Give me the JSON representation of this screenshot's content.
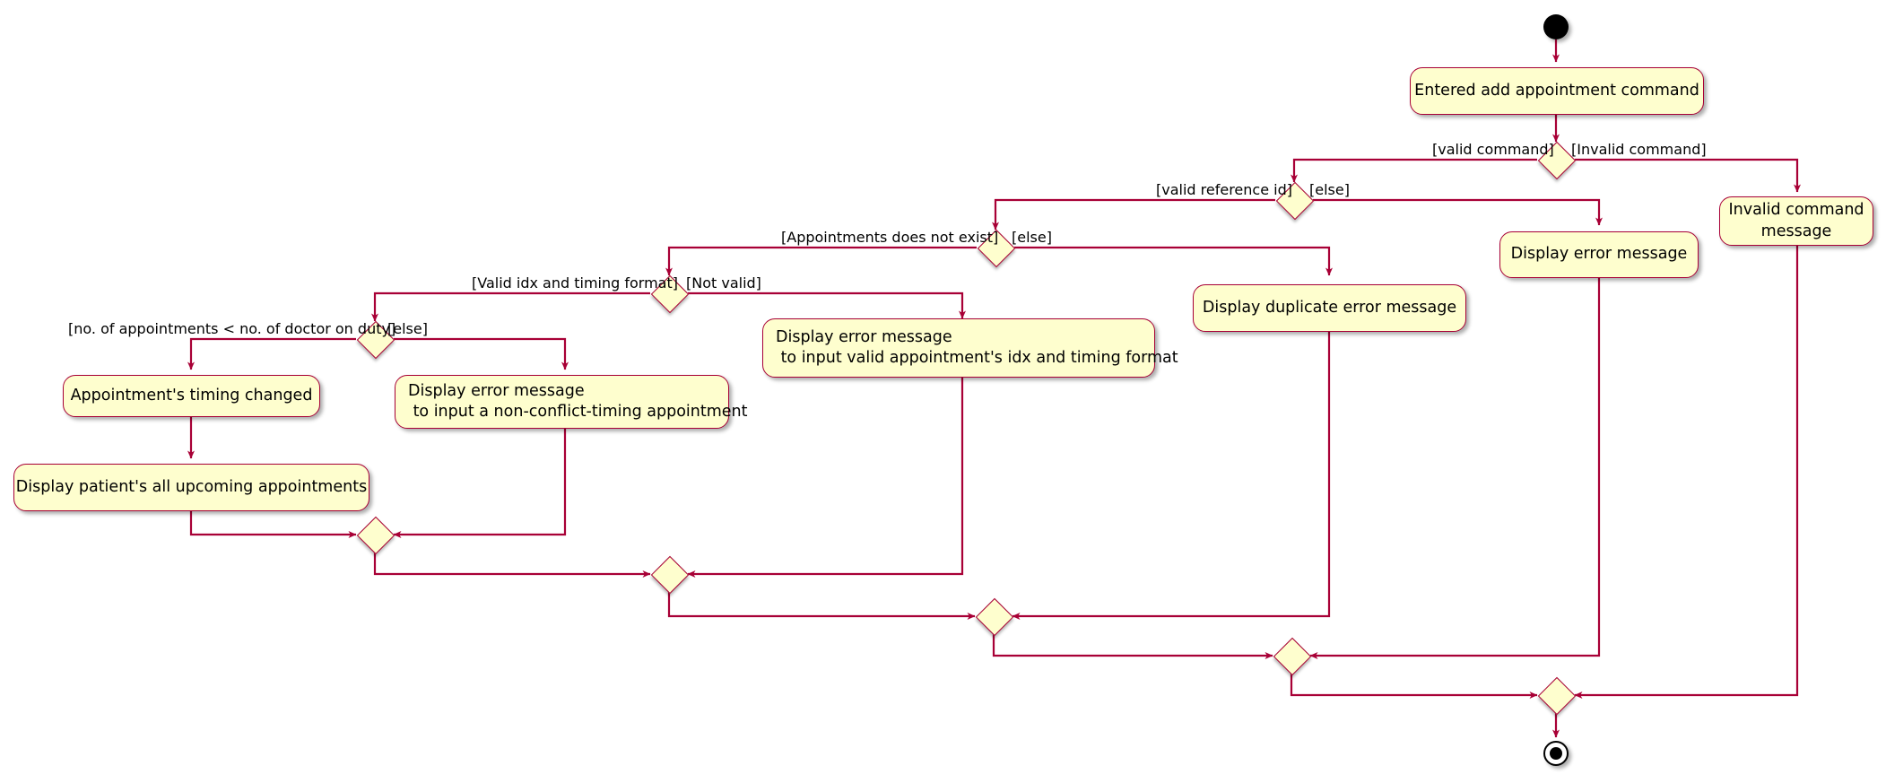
{
  "diagram": {
    "type": "uml-activity-diagram",
    "title": "Add appointment command activity diagram",
    "colors": {
      "node_fill": "#FEFECE",
      "node_border": "#A80036",
      "edge": "#A80036",
      "text": "#000000",
      "background": "#FFFFFF"
    },
    "nodes": [
      {
        "id": "start",
        "kind": "initial-node",
        "label": ""
      },
      {
        "id": "a1",
        "kind": "activity",
        "label": "Entered add appointment command"
      },
      {
        "id": "d1",
        "kind": "decision",
        "label": ""
      },
      {
        "id": "d2",
        "kind": "decision",
        "label": ""
      },
      {
        "id": "d3",
        "kind": "decision",
        "label": ""
      },
      {
        "id": "d4",
        "kind": "decision",
        "label": ""
      },
      {
        "id": "d5",
        "kind": "decision",
        "label": ""
      },
      {
        "id": "a2",
        "kind": "activity",
        "label": "Appointment's timing changed"
      },
      {
        "id": "a3",
        "kind": "activity",
        "label": "Display patient's all upcoming appointments"
      },
      {
        "id": "a4_line1",
        "kind": "activity",
        "label": "Display error message"
      },
      {
        "id": "a4_line2",
        "kind": "activity",
        "label": " to input a non-conflict-timing appointment"
      },
      {
        "id": "a5_line1",
        "kind": "activity",
        "label": "Display error message"
      },
      {
        "id": "a5_line2",
        "kind": "activity",
        "label": " to input valid appointment's idx and timing format"
      },
      {
        "id": "a6",
        "kind": "activity",
        "label": "Display duplicate error message"
      },
      {
        "id": "a7",
        "kind": "activity",
        "label": "Display error message"
      },
      {
        "id": "a8_line1",
        "kind": "activity",
        "label": "Invalid command"
      },
      {
        "id": "a8_line2",
        "kind": "activity",
        "label": "message"
      },
      {
        "id": "m1",
        "kind": "merge",
        "label": ""
      },
      {
        "id": "m2",
        "kind": "merge",
        "label": ""
      },
      {
        "id": "m3",
        "kind": "merge",
        "label": ""
      },
      {
        "id": "m4",
        "kind": "merge",
        "label": ""
      },
      {
        "id": "m5",
        "kind": "merge",
        "label": ""
      },
      {
        "id": "end",
        "kind": "final-node",
        "label": ""
      }
    ],
    "guards": {
      "valid_command": "[valid command]",
      "invalid_command": "[Invalid command]",
      "valid_reference_id": "[valid reference id]",
      "else_reference": "[else]",
      "appointments_not_exist": "[Appointments does not exist]",
      "else_appointments": "[else]",
      "valid_idx_timing": "[Valid idx and timing format]",
      "not_valid": "[Not valid]",
      "appointments_lt_doctors": "[no. of appointments < no. of doctor on duty]",
      "else_doctors": "[else]"
    },
    "activities": {
      "entered_add_appointment_command": "Entered add appointment command",
      "appointments_timing_changed": "Appointment's timing changed",
      "display_all_upcoming_appointments": "Display patient's all upcoming appointments",
      "display_error_nonconflict_l1": "Display error message",
      "display_error_nonconflict_l2": " to input a non-conflict-timing appointment",
      "display_error_idx_timing_l1": "Display error message",
      "display_error_idx_timing_l2": " to input valid appointment's idx and timing format",
      "display_duplicate_error_message": "Display duplicate error message",
      "display_error_message": "Display error message",
      "invalid_command_message_l1": "Invalid command",
      "invalid_command_message_l2": "message"
    }
  }
}
